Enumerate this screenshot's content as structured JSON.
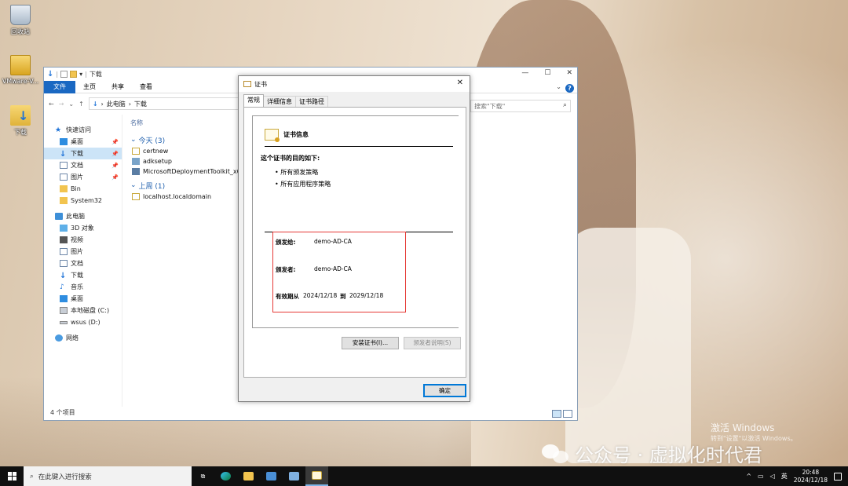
{
  "desktop": {
    "icons": [
      {
        "label": "回收站",
        "icon": "recycle-bin-icon"
      },
      {
        "label": "VMware-V...",
        "icon": "vmware-folder-icon"
      },
      {
        "label": "下载",
        "icon": "download-folder-icon"
      }
    ]
  },
  "explorer": {
    "title": "下载",
    "ribbon_tabs": [
      "文件",
      "主页",
      "共享",
      "查看"
    ],
    "address_path": [
      "此电脑",
      "下载"
    ],
    "search_placeholder": "搜索\"下载\"",
    "nav": {
      "quick_access": "快速访问",
      "quick_items": [
        {
          "label": "桌面",
          "icon": "desktop-icon",
          "pinned": true
        },
        {
          "label": "下载",
          "icon": "download-icon",
          "pinned": true
        },
        {
          "label": "文档",
          "icon": "documents-icon",
          "pinned": true
        },
        {
          "label": "图片",
          "icon": "pictures-icon",
          "pinned": true
        },
        {
          "label": "Bin",
          "icon": "folder-icon"
        },
        {
          "label": "System32",
          "icon": "folder-icon"
        }
      ],
      "this_pc": "此电脑",
      "pc_items": [
        {
          "label": "3D 对象",
          "icon": "3d-objects-icon"
        },
        {
          "label": "视频",
          "icon": "videos-icon"
        },
        {
          "label": "图片",
          "icon": "pictures-icon"
        },
        {
          "label": "文档",
          "icon": "documents-icon"
        },
        {
          "label": "下载",
          "icon": "download-icon"
        },
        {
          "label": "音乐",
          "icon": "music-icon"
        },
        {
          "label": "桌面",
          "icon": "desktop-icon"
        },
        {
          "label": "本地磁盘 (C:)",
          "icon": "local-disk-icon"
        },
        {
          "label": "wsus (D:)",
          "icon": "drive-icon"
        }
      ],
      "network": "网络"
    },
    "column_header": "名称",
    "groups": [
      {
        "label": "今天 (3)",
        "items": [
          "certnew",
          "adksetup",
          "MicrosoftDeploymentToolkit_x64"
        ]
      },
      {
        "label": "上周 (1)",
        "items": [
          "localhost.localdomain"
        ]
      }
    ],
    "status": "4 个项目"
  },
  "cert_dialog": {
    "title": "证书",
    "tabs": [
      "常规",
      "详细信息",
      "证书路径"
    ],
    "info_title": "证书信息",
    "purpose_heading": "这个证书的目的如下:",
    "purposes": [
      "• 所有颁发策略",
      "• 所有应用程序策略"
    ],
    "issued_to_label": "颁发给:",
    "issued_to_value": "demo-AD-CA",
    "issued_by_label": "颁发者:",
    "issued_by_value": "demo-AD-CA",
    "valid_from_label": "有效期从",
    "valid_from": "2024/12/18",
    "valid_to_label": "到",
    "valid_to": "2029/12/18",
    "install_button": "安装证书(I)...",
    "issuer_statement_button": "颁发者说明(S)",
    "ok_button": "确定"
  },
  "taskbar": {
    "search_placeholder": "在此键入进行搜索",
    "ime": "英",
    "time": "20:48",
    "date": "2024/12/18"
  },
  "activation": {
    "title": "激活 Windows",
    "subtitle": "转到\"设置\"以激活 Windows。"
  },
  "watermark": "公众号 · 虚拟化时代君"
}
